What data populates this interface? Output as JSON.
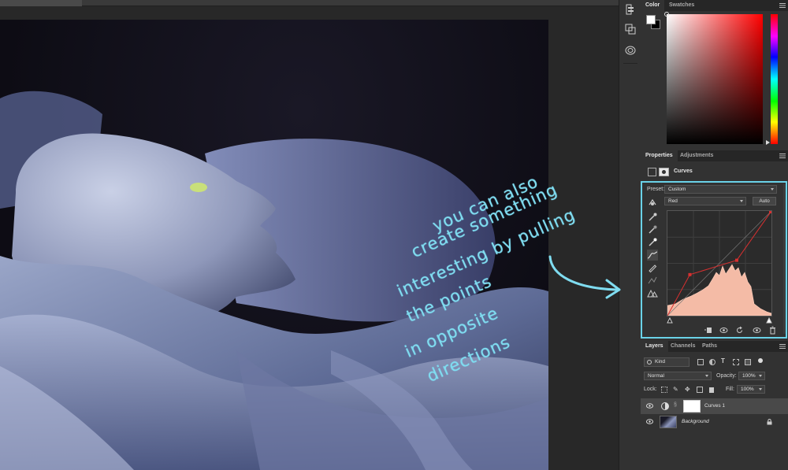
{
  "document": {
    "tab_title": ""
  },
  "toolstrip": {
    "icons": [
      "history-icon",
      "layer-comps-icon",
      "libraries-icon"
    ]
  },
  "color_panel": {
    "tabs": [
      "Color",
      "Swatches"
    ],
    "foreground": "#ffffff",
    "background": "#000000",
    "hue": "#ff0000"
  },
  "properties_panel": {
    "tabs": [
      "Properties",
      "Adjustments"
    ],
    "title": "Curves",
    "preset_label": "Preset:",
    "preset_value": "Custom",
    "channel_value": "Red",
    "auto_label": "Auto",
    "curve_points": [
      {
        "input": 0,
        "output": 0
      },
      {
        "input": 55,
        "output": 100
      },
      {
        "input": 170,
        "output": 135
      },
      {
        "input": 255,
        "output": 255
      }
    ],
    "accent": "#6ad2e8"
  },
  "layers_panel": {
    "tabs": [
      "Layers",
      "Channels",
      "Paths"
    ],
    "kind_label": "Kind",
    "blend_mode": "Normal",
    "opacity_label": "Opacity:",
    "opacity_value": "100%",
    "lock_label": "Lock:",
    "fill_label": "Fill:",
    "fill_value": "100%",
    "layers": [
      {
        "name": "Curves 1",
        "selected": true
      },
      {
        "name": "Background",
        "selected": false,
        "locked": true
      }
    ]
  },
  "annotation": {
    "lines": [
      "you can also",
      "create something",
      "interesting by pulling",
      "the points",
      "in opposite",
      "directions"
    ],
    "color": "#7fdcf0"
  }
}
